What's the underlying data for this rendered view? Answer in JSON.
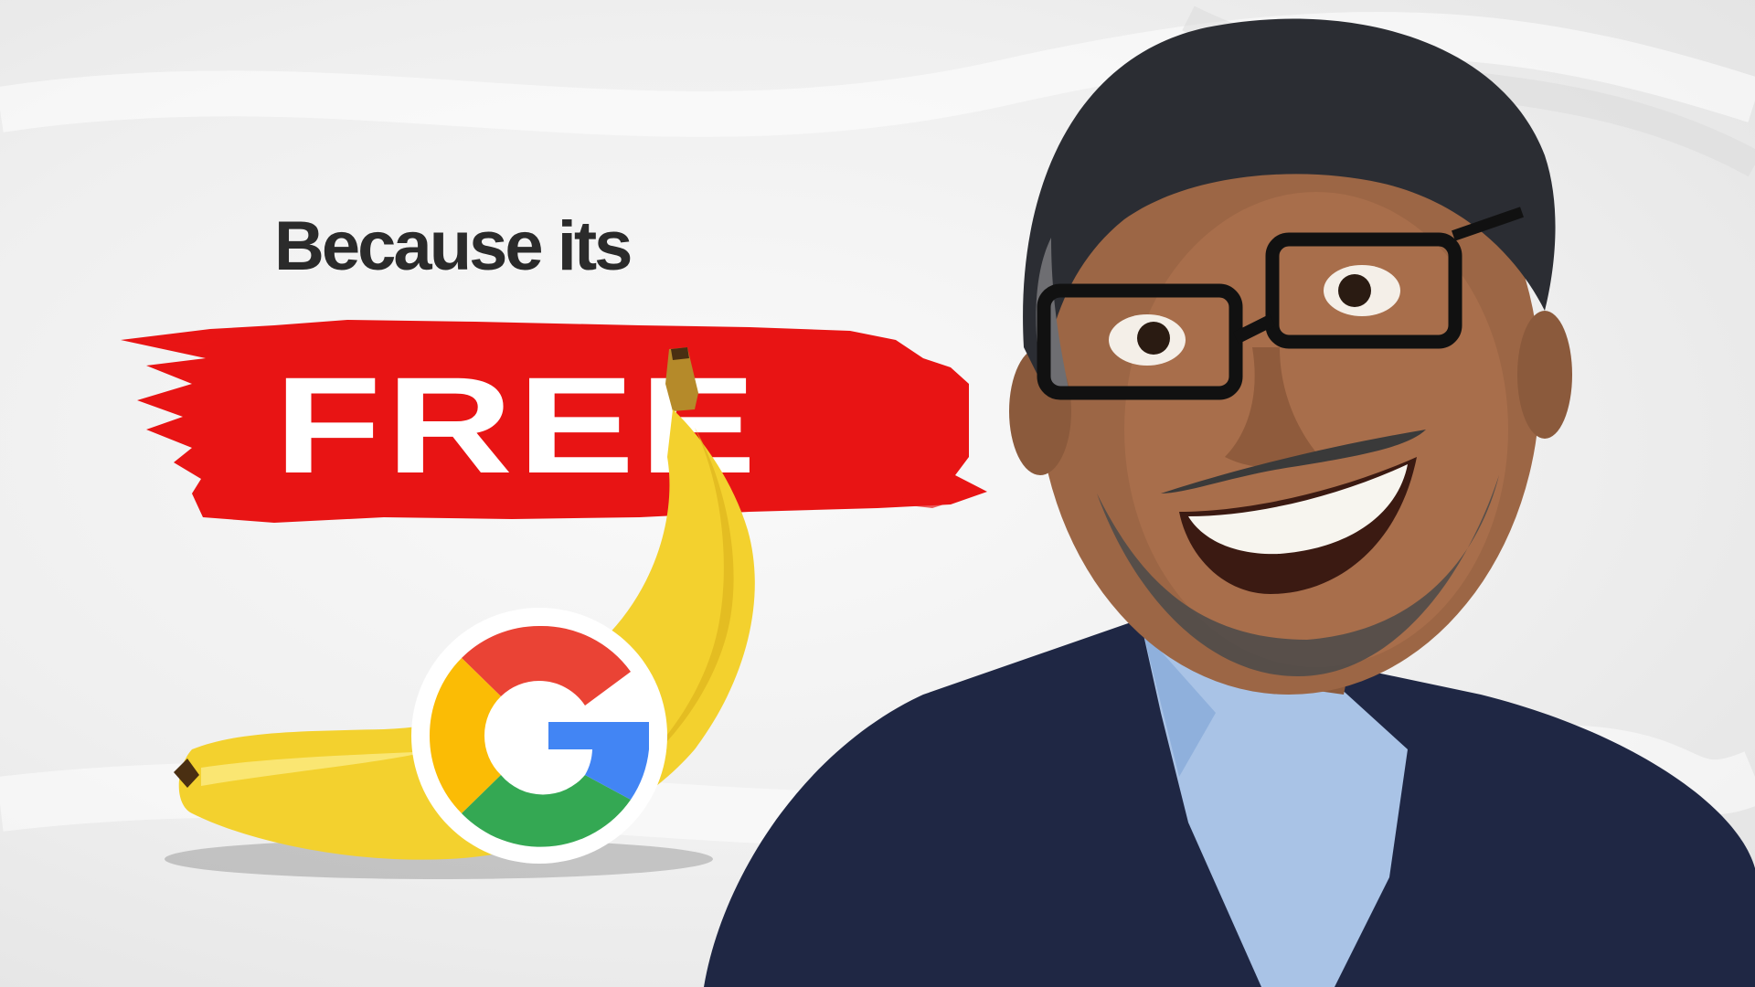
{
  "headline": {
    "line1": "Because its",
    "line2": "FREE"
  },
  "colors": {
    "accent_red": "#e81414",
    "headline_dark": "#2b2b2b",
    "banana_yellow": "#f3d12e",
    "google_blue": "#4285f4",
    "google_red": "#ea4335",
    "google_yellow": "#fbbc05",
    "google_green": "#34a853",
    "suit_navy": "#1f2744",
    "shirt_blue": "#a9c3e6"
  },
  "icons": {
    "logo": "google-g-logo"
  }
}
